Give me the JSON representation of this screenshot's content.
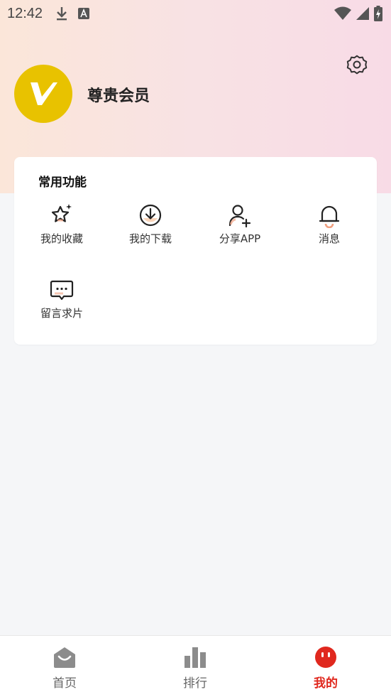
{
  "status_bar": {
    "time": "12:42",
    "left_icons": [
      "download-icon",
      "font-a-icon"
    ],
    "right_icons": [
      "wifi-icon",
      "signal-icon",
      "battery-charging-icon"
    ]
  },
  "header": {
    "username": "尊贵会员",
    "avatar_letter": "V",
    "avatar_color": "#e8c200",
    "settings_icon": "gear-icon"
  },
  "features": {
    "title": "常用功能",
    "items": [
      {
        "label": "我的收藏",
        "icon": "star-sparkle-icon"
      },
      {
        "label": "我的下载",
        "icon": "download-circle-icon"
      },
      {
        "label": "分享APP",
        "icon": "add-user-icon"
      },
      {
        "label": "消息",
        "icon": "bell-icon"
      },
      {
        "label": "留言求片",
        "icon": "chat-bubble-icon"
      }
    ]
  },
  "tabbar": {
    "items": [
      {
        "label": "首页",
        "icon": "home-icon",
        "active": false
      },
      {
        "label": "排行",
        "icon": "bar-chart-icon",
        "active": false
      },
      {
        "label": "我的",
        "icon": "profile-face-icon",
        "active": true
      }
    ],
    "active_color": "#e0281e"
  }
}
